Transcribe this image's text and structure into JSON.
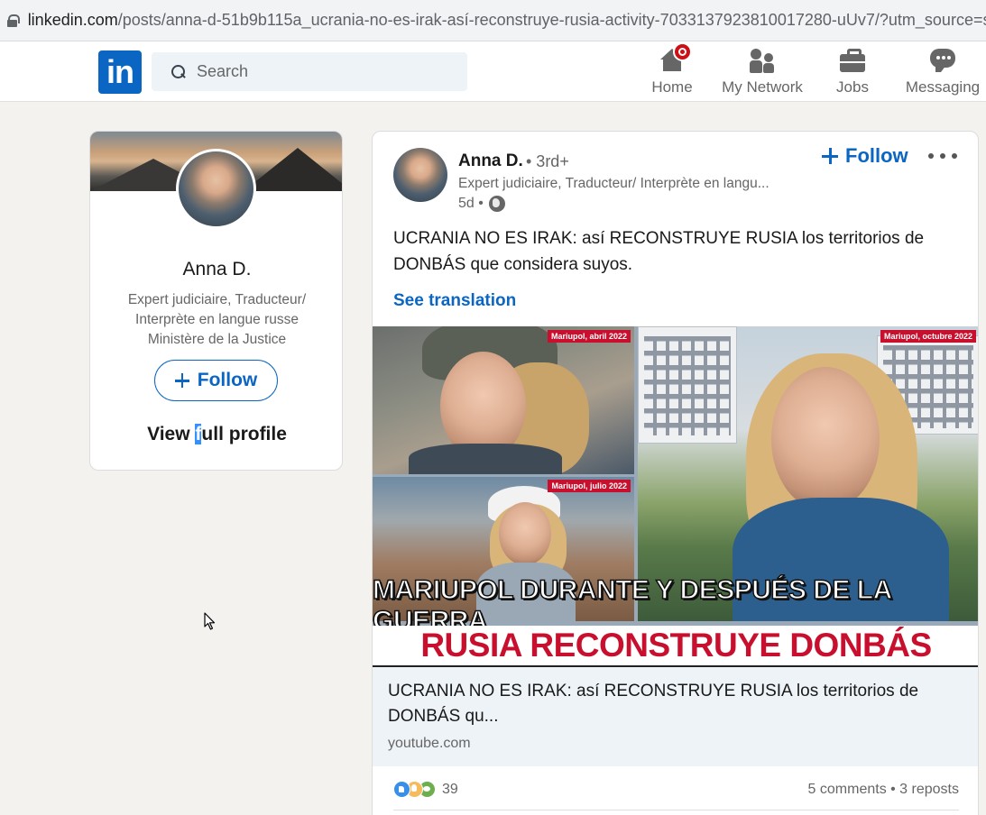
{
  "browser": {
    "url_domain": "linkedin.com",
    "url_path": "/posts/anna-d-51b9b115a_ucrania-no-es-irak-así-reconstruye-rusia-activity-7033137923810017280-uUv7/?utm_source=shar"
  },
  "nav": {
    "logo_text": "in",
    "search_placeholder": "Search",
    "items": [
      {
        "label": "Home",
        "icon": "home-icon"
      },
      {
        "label": "My Network",
        "icon": "network-icon"
      },
      {
        "label": "Jobs",
        "icon": "briefcase-icon"
      },
      {
        "label": "Messaging",
        "icon": "messaging-icon"
      }
    ]
  },
  "profile_card": {
    "name": "Anna D.",
    "headline": "Expert judiciaire, Traducteur/ Interprète en langue russe Ministère de la Justice",
    "follow_label": "Follow",
    "view_profile_pre": "View ",
    "view_profile_sel": "f",
    "view_profile_post": "ull profile"
  },
  "post": {
    "author_name": "Anna D.",
    "degree": "• 3rd+",
    "headline": "Expert judiciaire, Traducteur/ Interprète en langu...",
    "time": "5d •",
    "follow_label": "Follow",
    "text": "UCRANIA NO ES IRAK: así RECONSTRUYE RUSIA los territorios de DONBÁS que considera suyos.",
    "see_translation": "See translation",
    "thumbnail": {
      "tag_top_left": "Mariupol, abril 2022",
      "tag_bottom_left": "Mariupol, julio 2022",
      "tag_right": "Mariupol, octubre 2022",
      "banner_line1": "MARIUPOL DURANTE Y DESPUÉS DE LA GUERRA",
      "banner_line2": "RUSIA RECONSTRUYE DONBÁS"
    },
    "link_preview": {
      "title": "UCRANIA NO ES IRAK: así RECONSTRUYE RUSIA los territorios de DONBÁS qu...",
      "source": "youtube.com"
    },
    "social": {
      "reaction_count": "39",
      "comments_reposts": "5 comments • 3 reposts"
    }
  },
  "colors": {
    "brand": "#0a66c2",
    "notification": "#cc1016",
    "page_bg": "#f3f2ef",
    "banner_red": "#c8102e"
  }
}
